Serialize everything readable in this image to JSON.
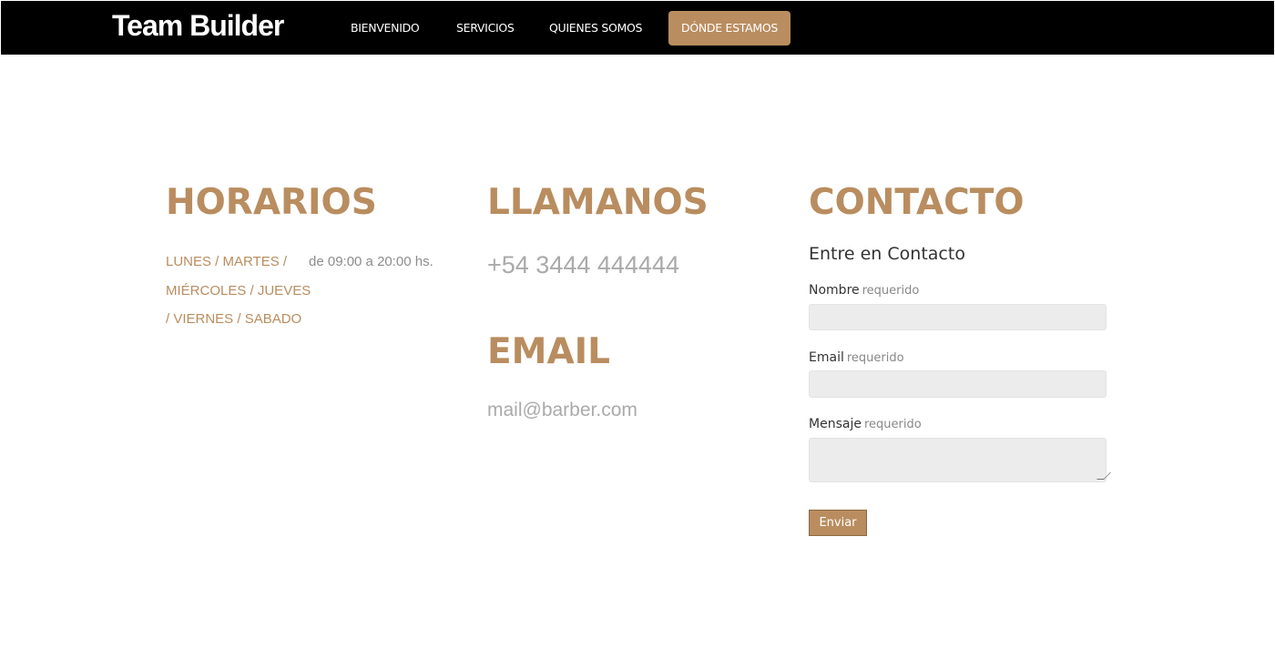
{
  "brand": "Team Builder",
  "nav": {
    "items": [
      {
        "label": "BIENVENIDO"
      },
      {
        "label": "SERVICIOS"
      },
      {
        "label": "QUIENES SOMOS"
      },
      {
        "label": "DÓNDE ESTAMOS",
        "active": true
      }
    ]
  },
  "colors": {
    "accent": "#b98d5f",
    "navbar_bg": "#000000",
    "muted_text": "#aaaaaa",
    "input_bg": "#ececec"
  },
  "horarios": {
    "heading": "HORARIOS",
    "days_line1": "LUNES / MARTES /",
    "days_line2": "MIÉRCOLES / JUEVES",
    "days_line3": "/ VIERNES / SABADO",
    "hours": "de 09:00 a 20:00 hs."
  },
  "llamanos": {
    "heading": "LLAMANOS",
    "phone": "+54 3444 444444"
  },
  "email_section": {
    "heading": "EMAIL",
    "address": "mail@barber.com"
  },
  "contacto": {
    "heading": "CONTACTO",
    "form_title": "Entre en Contacto",
    "fields": {
      "name": {
        "label": "Nombre",
        "required_text": "requerido",
        "value": ""
      },
      "email": {
        "label": "Email",
        "required_text": "requerido",
        "value": ""
      },
      "message": {
        "label": "Mensaje",
        "required_text": "requerido",
        "value": ""
      }
    },
    "submit_label": "Enviar"
  }
}
